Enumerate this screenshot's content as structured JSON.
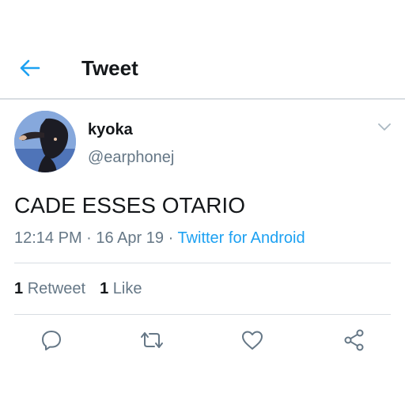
{
  "header": {
    "title": "Tweet",
    "back_icon": "arrow-left-icon",
    "accent_color": "#1da1f2"
  },
  "tweet": {
    "author_name": "kyoka",
    "author_handle": "@earphonej",
    "text": "CADE ESSES OTARIO",
    "time": "12:14 PM",
    "separator": " · ",
    "date": "16 Apr 19",
    "source": "Twitter for Android"
  },
  "stats": {
    "retweet_count": "1",
    "retweet_label": "Retweet",
    "like_count": "1",
    "like_label": "Like"
  },
  "actions": {
    "reply_icon": "reply-icon",
    "retweet_icon": "retweet-icon",
    "like_icon": "heart-icon",
    "share_icon": "share-icon"
  }
}
